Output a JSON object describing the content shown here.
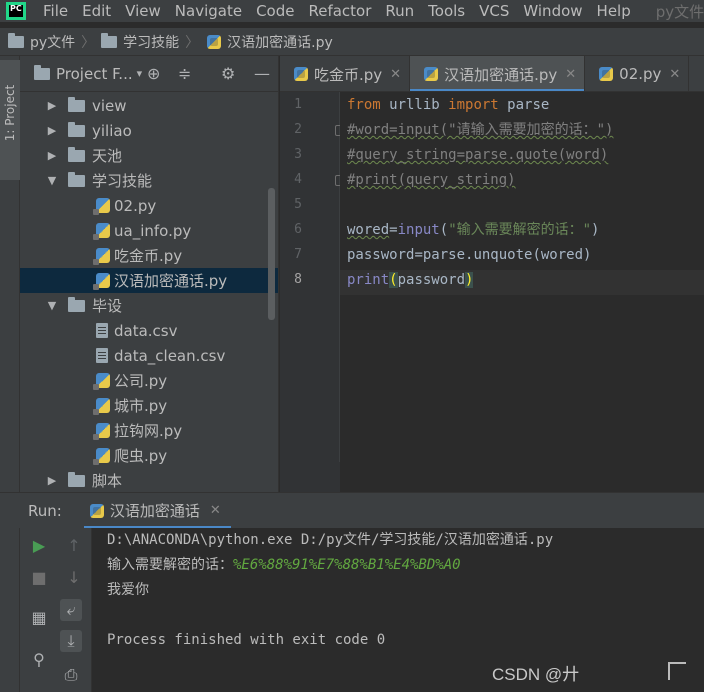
{
  "menu": {
    "items": [
      "File",
      "Edit",
      "View",
      "Navigate",
      "Code",
      "Refactor",
      "Run",
      "Tools",
      "VCS",
      "Window",
      "Help"
    ],
    "window_title": "py文件"
  },
  "breadcrumb": {
    "items": [
      "py文件",
      "学习技能",
      "汉语加密通话.py"
    ]
  },
  "left_strip": {
    "project_label": "1: Project"
  },
  "project_panel": {
    "title": "Project F...",
    "tree": [
      {
        "label": "view",
        "type": "folder",
        "expanded": false
      },
      {
        "label": "yiliao",
        "type": "folder",
        "expanded": false
      },
      {
        "label": "天池",
        "type": "folder",
        "expanded": false
      },
      {
        "label": "学习技能",
        "type": "folder",
        "expanded": true
      },
      {
        "label": "02.py",
        "type": "py"
      },
      {
        "label": "ua_info.py",
        "type": "py"
      },
      {
        "label": "吃金币.py",
        "type": "py"
      },
      {
        "label": "汉语加密通话.py",
        "type": "py",
        "selected": true
      },
      {
        "label": "毕设",
        "type": "folder",
        "expanded": true
      },
      {
        "label": "data.csv",
        "type": "file"
      },
      {
        "label": "data_clean.csv",
        "type": "file"
      },
      {
        "label": "公司.py",
        "type": "py"
      },
      {
        "label": "城市.py",
        "type": "py"
      },
      {
        "label": "拉钩网.py",
        "type": "py"
      },
      {
        "label": "爬虫.py",
        "type": "py"
      },
      {
        "label": "脚本",
        "type": "folder",
        "expanded": false
      }
    ]
  },
  "editor": {
    "tabs": [
      {
        "label": "吃金币.py",
        "active": false
      },
      {
        "label": "汉语加密通话.py",
        "active": true
      },
      {
        "label": "02.py",
        "active": false
      }
    ],
    "line_numbers": [
      "1",
      "2",
      "3",
      "4",
      "5",
      "6",
      "7",
      "8"
    ],
    "current_line": 8,
    "code": {
      "l1_kw1": "from",
      "l1_mod": " urllib ",
      "l1_kw2": "import",
      "l1_name": " parse",
      "l2": "#word=input(\"请输入需要加密的话：\")",
      "l3": "#query_string=parse.quote(word)",
      "l4": "#print(query_string)",
      "l6_var": "wored",
      "l6_eq": "=",
      "l6_fn": "input",
      "l6_open": "(",
      "l6_str": "\"输入需要解密的话：\"",
      "l6_close": ")",
      "l7_var": "password",
      "l7_rest": "=parse.unquote(wored)",
      "l8_fn": "print",
      "l8_open": "(",
      "l8_arg": "password",
      "l8_close": ")"
    }
  },
  "run": {
    "label": "Run:",
    "tab_label": "汉语加密通话",
    "output": {
      "command": "D:\\ANACONDA\\python.exe D:/py文件/学习技能/汉语加密通话.py",
      "prompt": "输入需要解密的话：",
      "user_input": "%E6%88%91%E7%88%B1%E4%BD%A0",
      "result": "我爱你",
      "finished": "Process finished with exit code 0"
    }
  },
  "watermark": "CSDN @廾",
  "colors": {
    "keyword": "#cc7832",
    "comment": "#808080",
    "string": "#6a8759",
    "builtin": "#8888c6",
    "input_text": "#62a840",
    "selection": "#0d293e",
    "tab_underline": "#4a88c7"
  }
}
